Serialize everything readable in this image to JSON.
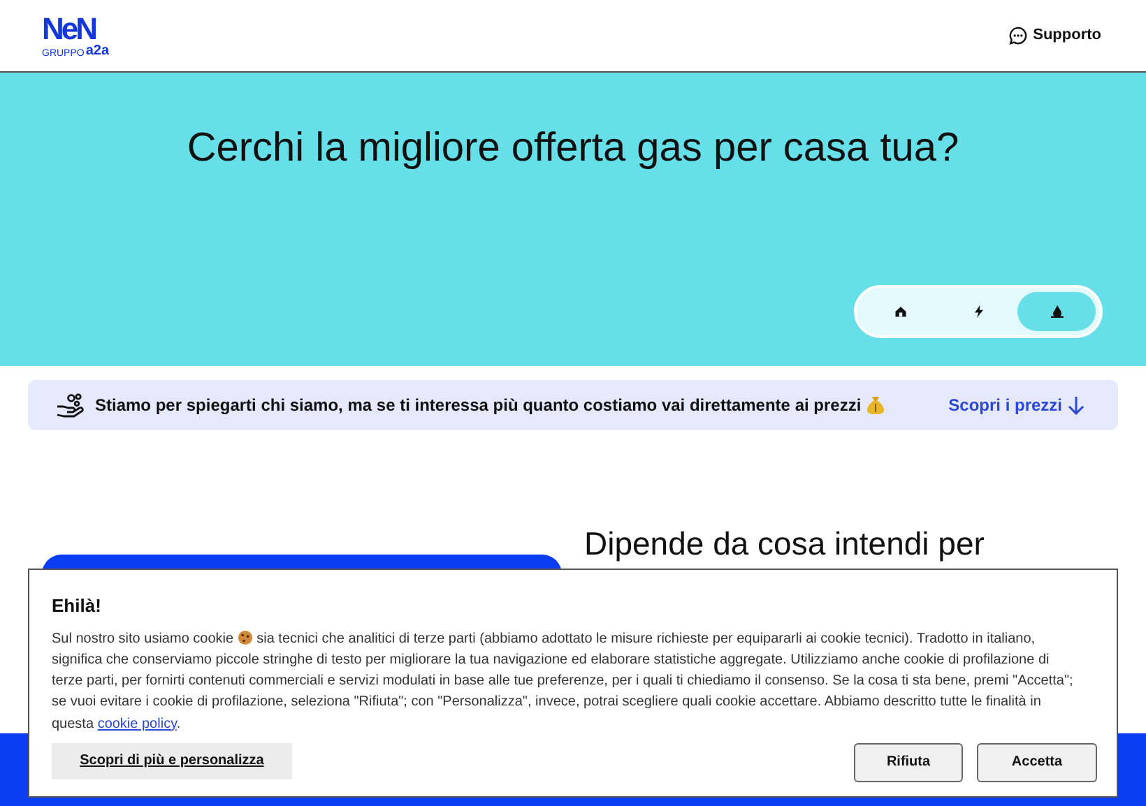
{
  "header": {
    "logo": {
      "brand": "NeN",
      "group": "GRUPPO",
      "group_brand": "a2a"
    },
    "support": "Supporto"
  },
  "hero": {
    "title": "Cerchi la migliore offerta gas per casa tua?",
    "tabs": [
      {
        "kind": "home",
        "selected": false
      },
      {
        "kind": "electricity",
        "selected": false
      },
      {
        "kind": "gas",
        "selected": true
      }
    ]
  },
  "info_banner": {
    "text_before": "Stiamo per spiegarti chi siamo, ma se ti interessa più quanto costiamo vai direttamente ai prezzi",
    "link": "Scopri i prezzi"
  },
  "section": {
    "heading": "Dipende da cosa intendi per"
  },
  "cookie_banner": {
    "title": "Ehilà!",
    "text_before": "Sul nostro sito usiamo cookie",
    "text": "sia tecnici che analitici di terze parti (abbiamo adottato le misure richieste per equipararli ai cookie tecnici). Tradotto in italiano, significa che conserviamo piccole stringhe di testo per migliorare la tua navigazione ed elaborare statistiche aggregate. Utilizziamo anche cookie di profilazione di terze parti, per fornirti contenuti commerciali e servizi modulati in base alle tue preferenze, per i quali ti chiediamo il consenso. Se la cosa ti sta bene, premi \"Accetta\"; se vuoi evitare i cookie di profilazione, seleziona \"Rifiuta\"; con \"Personalizza\", invece, potrai scegliere quali cookie accettare. Abbiamo descritto tutte le finalità in questa",
    "link": "cookie policy",
    "link_suffix": ".",
    "buttons": [
      {
        "kind": "link",
        "label": "Scopri di più e personalizza"
      },
      {
        "kind": "secondary",
        "label": "Rifiuta"
      },
      {
        "kind": "secondary",
        "label": "Accetta"
      }
    ]
  }
}
